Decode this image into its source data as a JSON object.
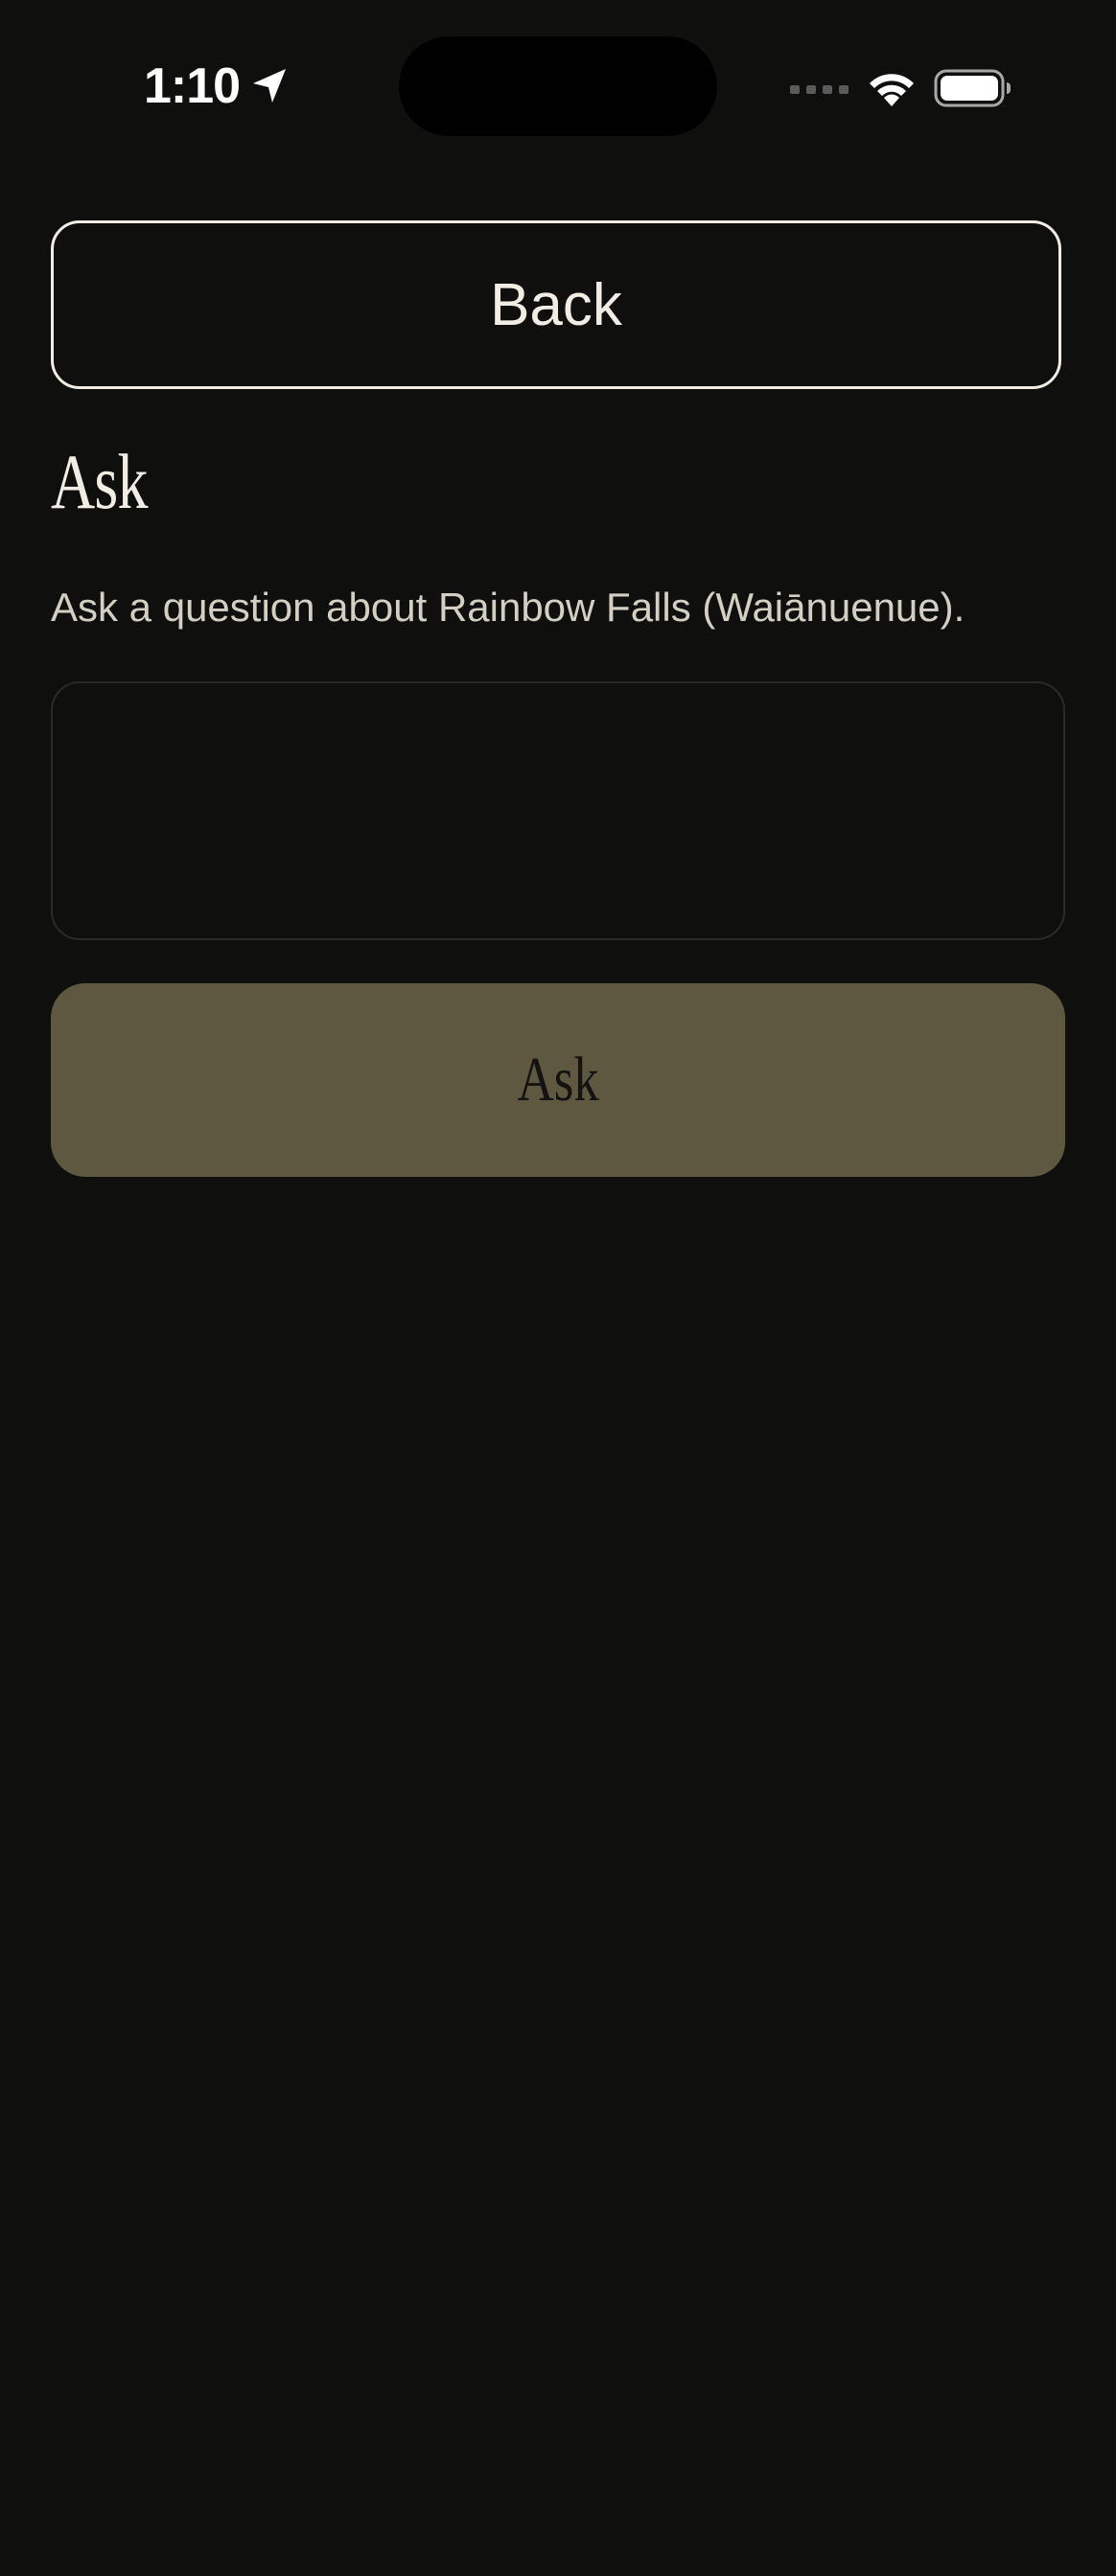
{
  "status_bar": {
    "time": "1:10",
    "icons": [
      "location-arrow-icon",
      "cellular-signal-icon",
      "wifi-icon",
      "battery-icon"
    ]
  },
  "header": {
    "back_label": "Back"
  },
  "main": {
    "title": "Ask",
    "subtitle": "Ask a question about Rainbow Falls (Waiānuenue).",
    "question_input": {
      "value": "",
      "placeholder": ""
    },
    "ask_label": "Ask"
  },
  "colors": {
    "background": "#0f0f0e",
    "text": "#f2ede4",
    "muted_text": "#d4cfc3",
    "input_border": "#2b2a27",
    "ask_button": "#5f5841",
    "ask_button_text": "#141311"
  }
}
